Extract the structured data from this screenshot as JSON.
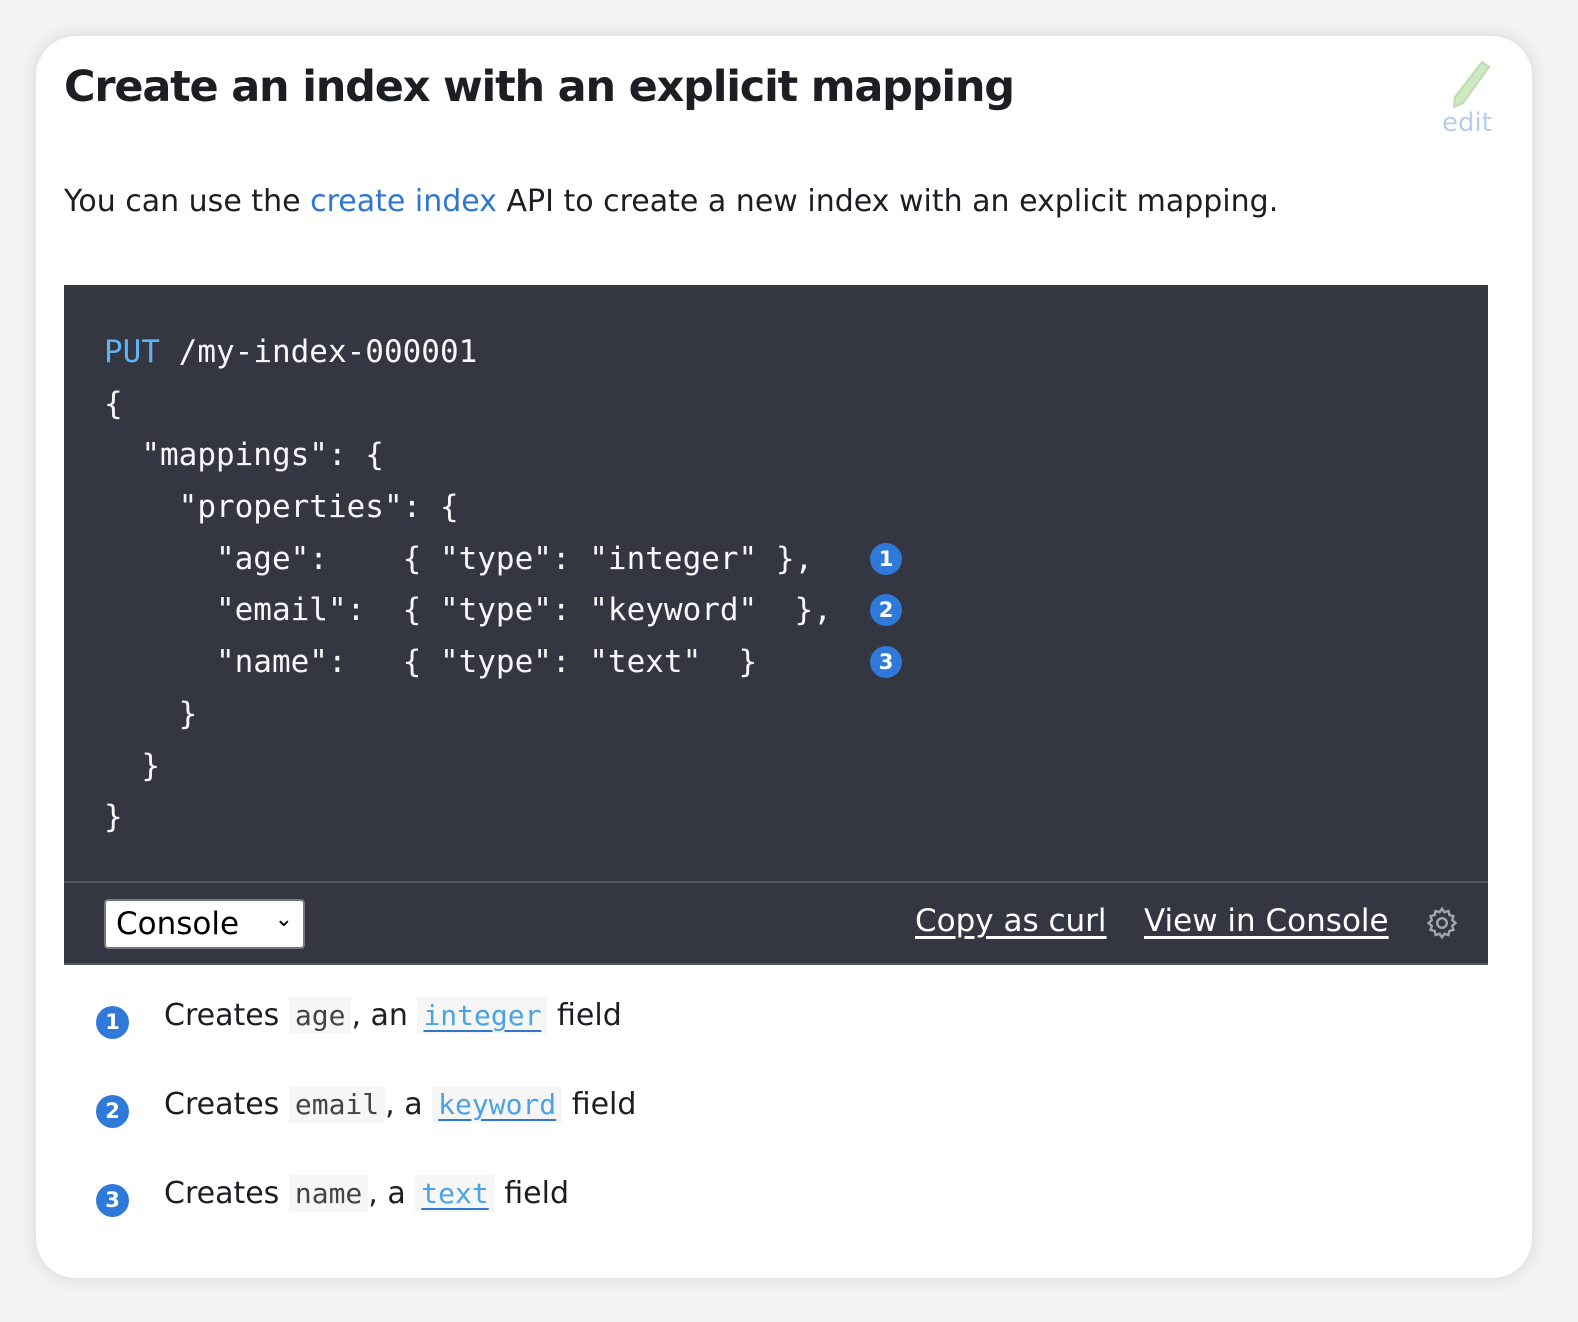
{
  "title": "Create an index with an explicit mapping",
  "edit_label": "edit",
  "intro": {
    "before": "You can use the ",
    "link": "create index",
    "after": " API to create a new index with an explicit mapping."
  },
  "code": {
    "method": "PUT",
    "path": " /my-index-000001",
    "lines": [
      {
        "text": "{",
        "callout": null
      },
      {
        "text": "  \"mappings\": {",
        "callout": null
      },
      {
        "text": "    \"properties\": {",
        "callout": null
      },
      {
        "text": "      \"age\":    { \"type\": \"integer\" },",
        "callout": "1"
      },
      {
        "text": "      \"email\":  { \"type\": \"keyword\"  },",
        "callout": "2"
      },
      {
        "text": "      \"name\":   { \"type\": \"text\"  }",
        "callout": "3"
      },
      {
        "text": "    }",
        "callout": null
      },
      {
        "text": "  }",
        "callout": null
      },
      {
        "text": "}",
        "callout": null
      }
    ]
  },
  "toolbar": {
    "select_value": "Console",
    "copy_curl": "Copy as curl",
    "view_console": "View in Console",
    "settings_icon": "gear-icon"
  },
  "callouts": [
    {
      "num": "1",
      "pre": "Creates ",
      "code": "age",
      "mid": ", an ",
      "link": "integer",
      "post": " field"
    },
    {
      "num": "2",
      "pre": "Creates ",
      "code": "email",
      "mid": ", a ",
      "link": "keyword",
      "post": " field"
    },
    {
      "num": "3",
      "pre": "Creates ",
      "code": "name",
      "mid": ", a ",
      "link": "text",
      "post": " field"
    }
  ],
  "colors": {
    "accent": "#2f77d0",
    "code_bg": "#343741",
    "callout": "#2f7ad8"
  }
}
